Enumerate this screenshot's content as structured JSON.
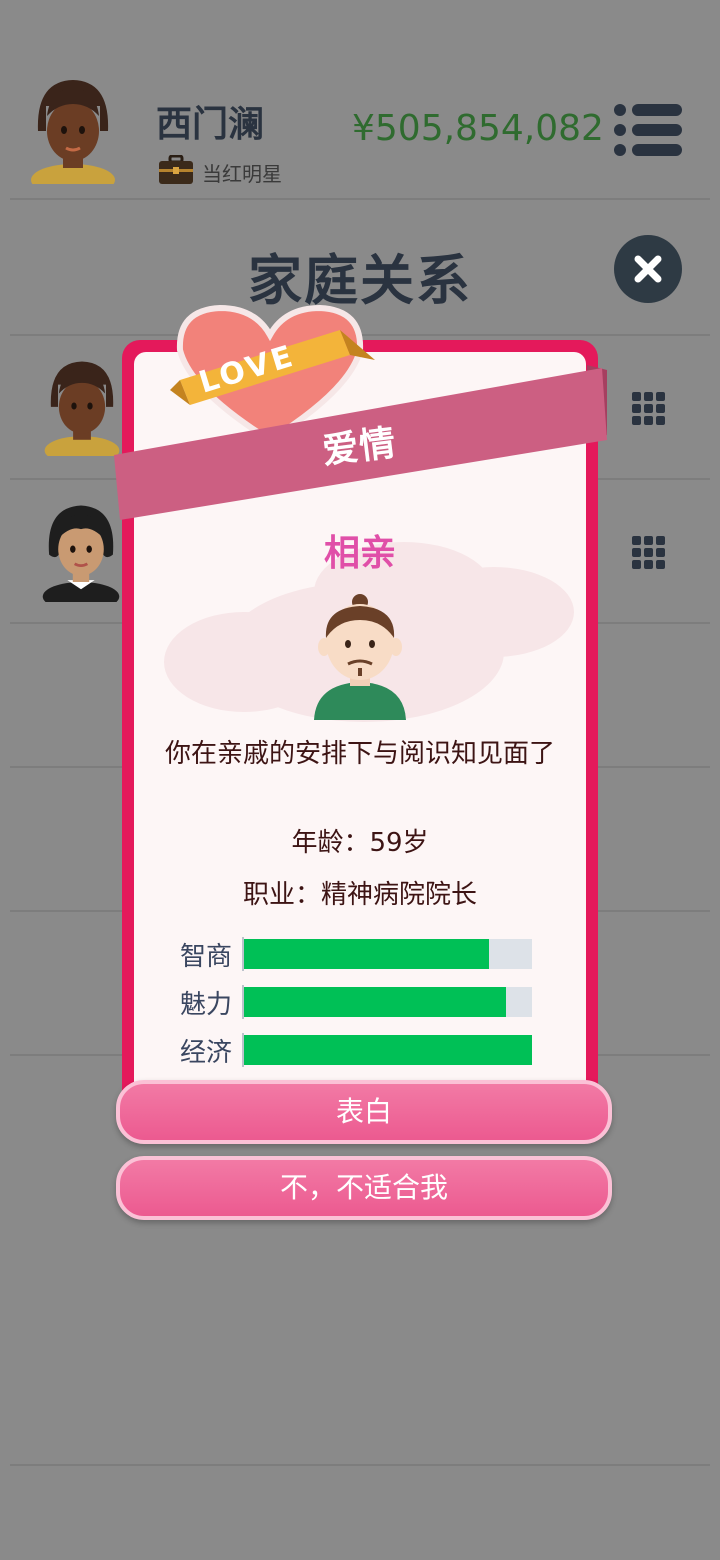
{
  "player": {
    "name": "西门澜",
    "job": "当红明星",
    "money": "¥505,854,082"
  },
  "page": {
    "title": "家庭关系"
  },
  "modal": {
    "banner_text": "爱情",
    "heart_badge_text": "LOVE",
    "event_title": "相亲",
    "description": "你在亲戚的安排下与阅识知见面了",
    "age_text": "年龄：59岁",
    "career_text": "职业：精神病院院长",
    "stats": [
      {
        "label": "智商",
        "value": 0.85
      },
      {
        "label": "魅力",
        "value": 0.91
      },
      {
        "label": "经济",
        "value": 1.0
      }
    ],
    "confess_button": "表白",
    "decline_button": "不，不适合我"
  },
  "colors": {
    "modal_border": "#e4195b",
    "stat_fill": "#00c056",
    "button": "#ec5a90",
    "money": "#2f6b2f",
    "title_pink": "#e04fa8"
  },
  "icons": {
    "menu": "menu-icon",
    "close": "close-icon",
    "briefcase": "briefcase-icon",
    "grid": "grid-icon"
  }
}
